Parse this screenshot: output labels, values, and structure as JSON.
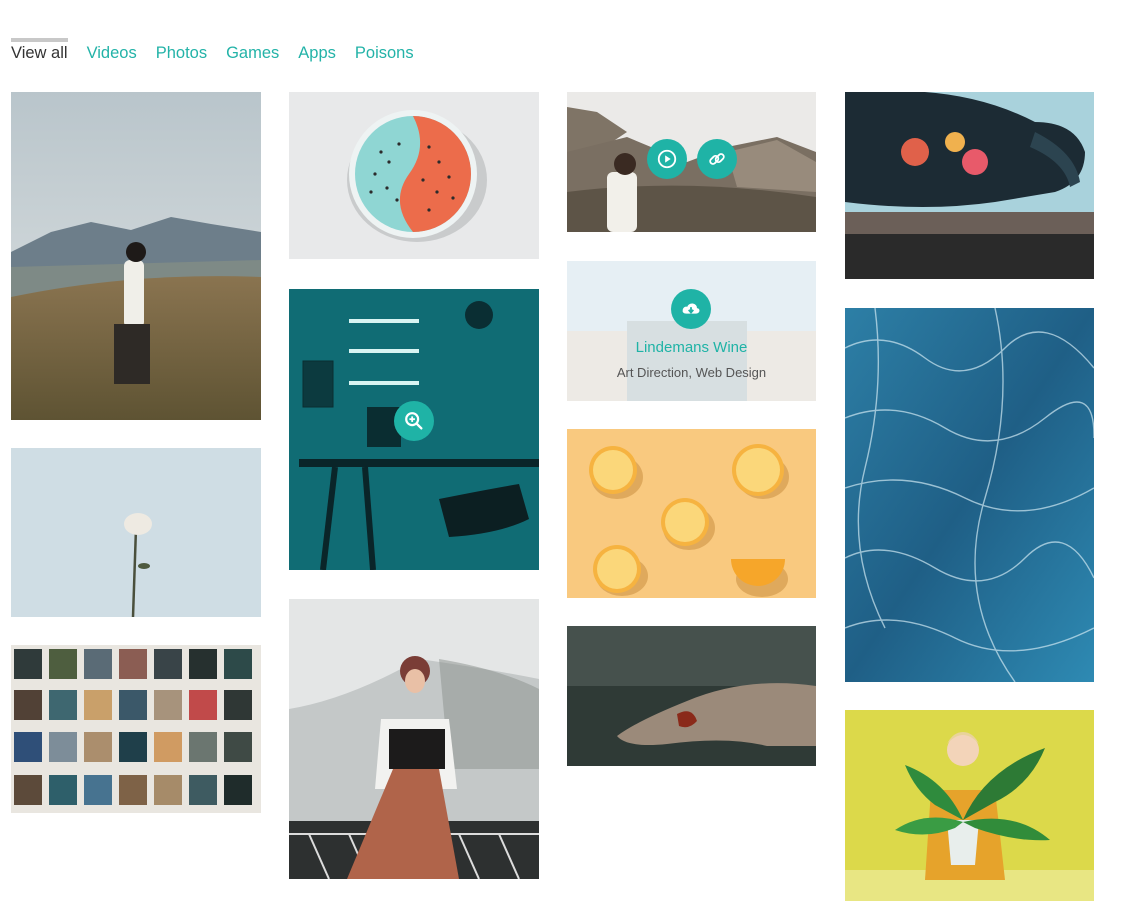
{
  "filters": [
    {
      "label": "View all",
      "active": true
    },
    {
      "label": "Videos"
    },
    {
      "label": "Photos"
    },
    {
      "label": "Games"
    },
    {
      "label": "Apps"
    },
    {
      "label": "Poisons"
    }
  ],
  "portfolio": {
    "hover_item": {
      "title": "Lindemans Wine",
      "subtitle": "Art Direction, Web Design"
    },
    "icons": [
      "play-icon",
      "link-icon",
      "zoom-in-icon",
      "cloud-download-icon"
    ]
  },
  "colors": {
    "accent": "#1fb3a6",
    "active_filter_text": "#333333",
    "filter_text": "#23b3a8"
  }
}
